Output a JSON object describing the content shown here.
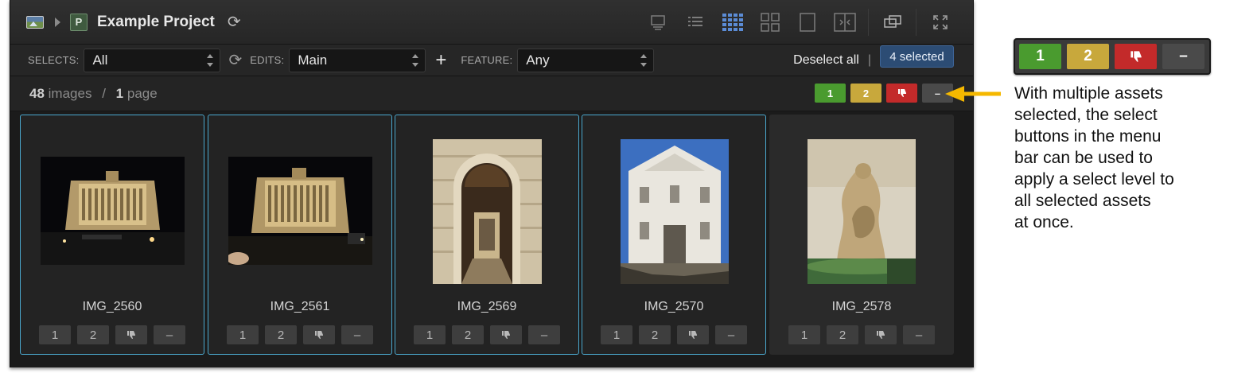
{
  "project": {
    "badge": "P",
    "title": "Example Project"
  },
  "filters": {
    "selects_label": "SELECTS:",
    "selects_value": "All",
    "edits_label": "EDITS:",
    "edits_value": "Main",
    "feature_label": "FEATURE:",
    "feature_value": "Any"
  },
  "selection": {
    "deselect_label": "Deselect all",
    "separator": "|",
    "selected_label": "4 selected"
  },
  "info": {
    "image_count": "48",
    "images_label": "images",
    "slash": "/",
    "page_count": "1",
    "page_label": "page"
  },
  "select_buttons": {
    "one": "1",
    "two": "2",
    "reject_icon": "thumbs-down-icon",
    "clear": "–"
  },
  "assets": [
    {
      "name": "IMG_2560",
      "selected": true
    },
    {
      "name": "IMG_2561",
      "selected": true
    },
    {
      "name": "IMG_2569",
      "selected": true
    },
    {
      "name": "IMG_2570",
      "selected": true
    },
    {
      "name": "IMG_2578",
      "selected": false
    }
  ],
  "callout": {
    "lines": [
      "With multiple assets",
      "selected, the select",
      "buttons in the menu",
      "bar can be used to",
      "apply a select level to",
      "all selected assets",
      "at once."
    ]
  },
  "colors": {
    "select_1": "#4a9b2f",
    "select_2": "#c8a83c",
    "reject": "#c32a2a",
    "clear": "#4a4a4a",
    "selected_border": "#4ba9cf",
    "arrow": "#f5b800"
  }
}
